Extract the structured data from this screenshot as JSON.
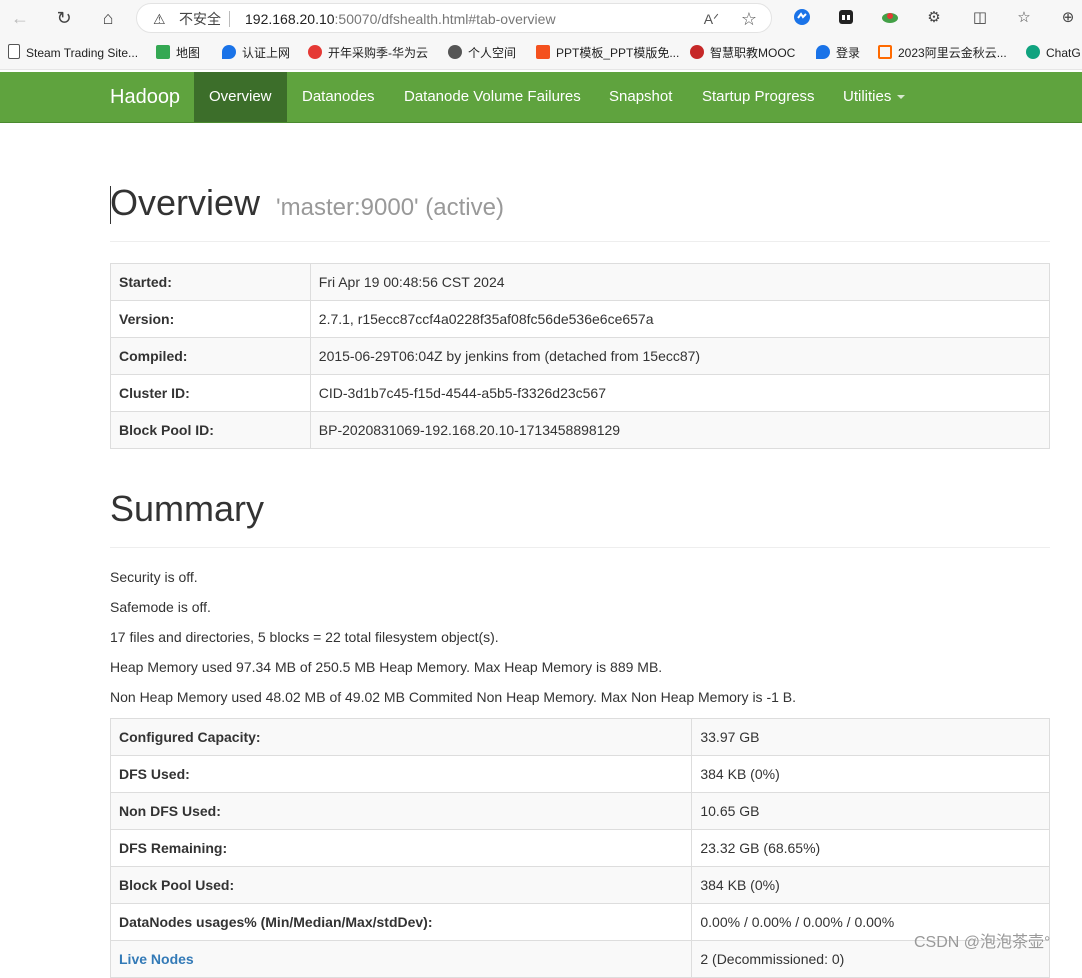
{
  "browser": {
    "insecure_label": "不安全",
    "url_host": "192.168.20.10",
    "url_path": ":50070/dfshealth.html#tab-overview",
    "bookmarks": [
      {
        "label": "Steam Trading Site...",
        "color": "#ffffff"
      },
      {
        "label": "地图",
        "color": "#34a853"
      },
      {
        "label": "认证上网",
        "color": "#1a73e8"
      },
      {
        "label": "开年采购季-华为云",
        "color": "#e53935"
      },
      {
        "label": "个人空间",
        "color": "#555555"
      },
      {
        "label": "PPT模板_PPT模版免...",
        "color": "#f4511e"
      },
      {
        "label": "智慧职教MOOC",
        "color": "#c62828"
      },
      {
        "label": "登录",
        "color": "#1a73e8"
      },
      {
        "label": "2023阿里云金秋云...",
        "color": "#ff6a00"
      },
      {
        "label": "ChatG",
        "color": "#10a37f"
      }
    ]
  },
  "navbar": {
    "brand": "Hadoop",
    "items": [
      "Overview",
      "Datanodes",
      "Datanode Volume Failures",
      "Snapshot",
      "Startup Progress",
      "Utilities"
    ],
    "accent": "#5fa33e",
    "active_bg": "#3c6e2a"
  },
  "overview": {
    "title": "Overview",
    "subtitle": "'master:9000' (active)",
    "rows": [
      {
        "key": "Started:",
        "value": "Fri Apr 19 00:48:56 CST 2024"
      },
      {
        "key": "Version:",
        "value": "2.7.1, r15ecc87ccf4a0228f35af08fc56de536e6ce657a"
      },
      {
        "key": "Compiled:",
        "value": "2015-06-29T06:04Z by jenkins from (detached from 15ecc87)"
      },
      {
        "key": "Cluster ID:",
        "value": "CID-3d1b7c45-f15d-4544-a5b5-f3326d23c567"
      },
      {
        "key": "Block Pool ID:",
        "value": "BP-2020831069-192.168.20.10-1713458898129"
      }
    ]
  },
  "summary": {
    "title": "Summary",
    "lines": [
      "Security is off.",
      "Safemode is off.",
      "17 files and directories, 5 blocks = 22 total filesystem object(s).",
      "Heap Memory used 97.34 MB of 250.5 MB Heap Memory. Max Heap Memory is 889 MB.",
      "Non Heap Memory used 48.02 MB of 49.02 MB Commited Non Heap Memory. Max Non Heap Memory is -1 B."
    ],
    "rows": [
      {
        "key": "Configured Capacity:",
        "value": "33.97 GB"
      },
      {
        "key": "DFS Used:",
        "value": "384 KB (0%)"
      },
      {
        "key": "Non DFS Used:",
        "value": "10.65 GB"
      },
      {
        "key": "DFS Remaining:",
        "value": "23.32 GB (68.65%)"
      },
      {
        "key": "Block Pool Used:",
        "value": "384 KB (0%)"
      },
      {
        "key": "DataNodes usages% (Min/Median/Max/stdDev):",
        "value": "0.00% / 0.00% / 0.00% / 0.00%"
      },
      {
        "key": "Live Nodes",
        "value": "2 (Decommissioned: 0)"
      }
    ]
  },
  "watermark": "CSDN @泡泡茶壶°"
}
